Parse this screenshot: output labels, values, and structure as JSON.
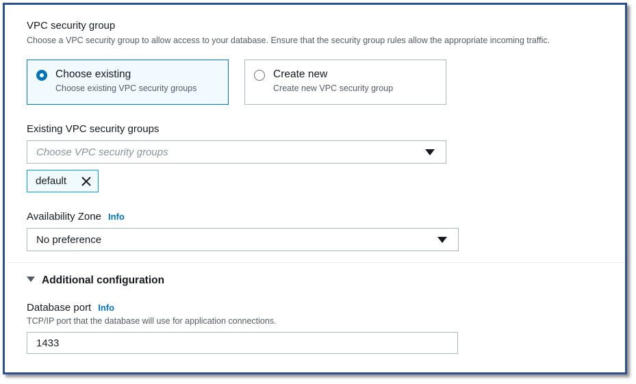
{
  "vpc_security_group": {
    "title": "VPC security group",
    "description": "Choose a VPC security group to allow access to your database. Ensure that the security group rules allow the appropriate incoming traffic.",
    "options": [
      {
        "label": "Choose existing",
        "sublabel": "Choose existing VPC security groups",
        "selected": true
      },
      {
        "label": "Create new",
        "sublabel": "Create new VPC security group",
        "selected": false
      }
    ]
  },
  "existing_groups": {
    "label": "Existing VPC security groups",
    "placeholder": "Choose VPC security groups",
    "tokens": [
      {
        "label": "default",
        "remove_icon": "close-icon"
      }
    ]
  },
  "availability_zone": {
    "label": "Availability Zone",
    "info": "Info",
    "value": "No preference"
  },
  "additional_configuration": {
    "label": "Additional configuration",
    "expanded": true
  },
  "database_port": {
    "label": "Database port",
    "info": "Info",
    "description": "TCP/IP port that the database will use for application connections.",
    "value": "1433"
  },
  "colors": {
    "accent": "#0073bb",
    "frame_border": "#2e4e8e",
    "selected_bg": "#f1faff",
    "token_border": "#00a1c9"
  }
}
